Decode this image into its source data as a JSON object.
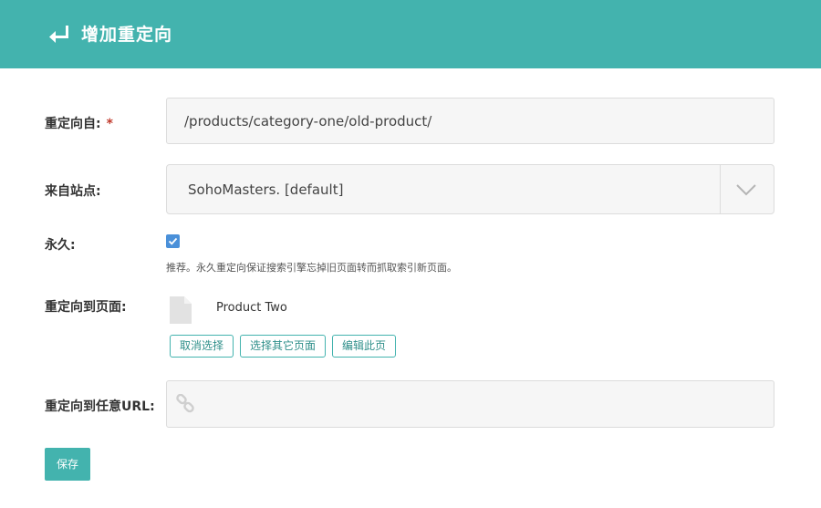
{
  "header": {
    "title": "增加重定向",
    "icon": "return-arrow-icon"
  },
  "form": {
    "redirect_from": {
      "label": "重定向自:",
      "required_mark": "*",
      "value": "/products/category-one/old-product/"
    },
    "site": {
      "label": "来自站点:",
      "value": "SohoMasters. [default]"
    },
    "permanent": {
      "label": "永久:",
      "checked": true,
      "hint": "推荐。永久重定向保证搜索引擎忘掉旧页面转而抓取索引新页面。"
    },
    "redirect_to_page": {
      "label": "重定向到页面:",
      "page_name": "Product Two",
      "buttons": {
        "deselect": "取消选择",
        "choose_other": "选择其它页面",
        "edit": "编辑此页"
      }
    },
    "redirect_to_url": {
      "label": "重定向到任意URL:",
      "value": ""
    }
  },
  "actions": {
    "save": "保存"
  },
  "colors": {
    "accent": "#43b3ae",
    "checkbox": "#4a90d9",
    "required": "#c0392b"
  }
}
